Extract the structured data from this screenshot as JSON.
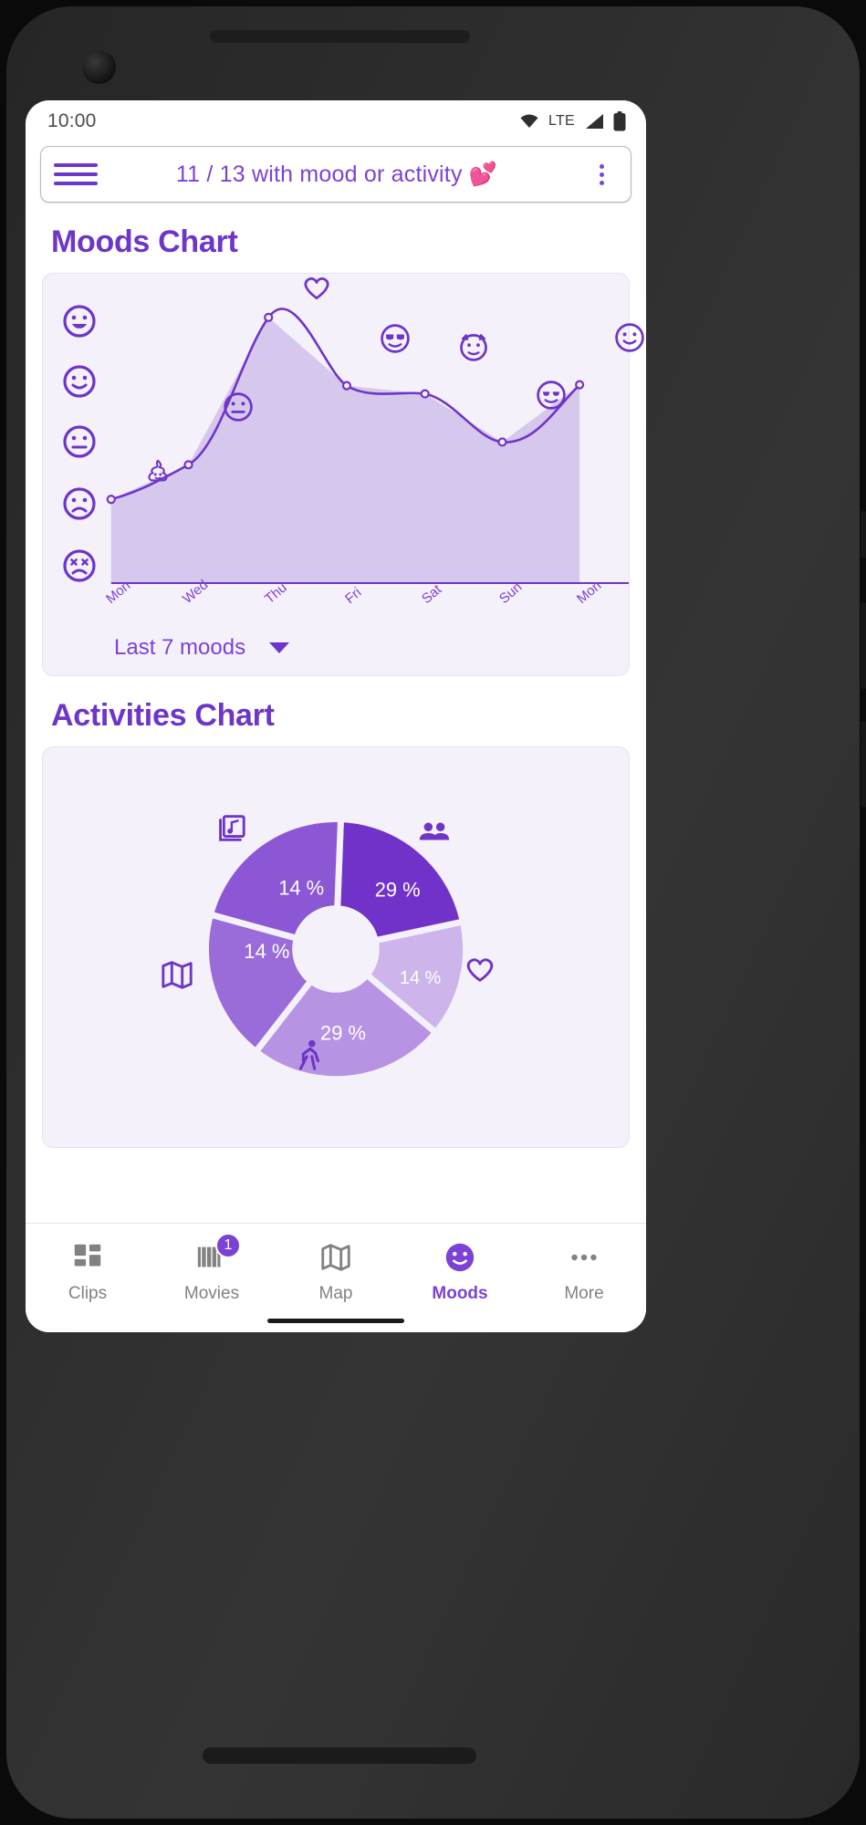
{
  "status_bar": {
    "time": "10:00",
    "network_label": "LTE",
    "icons": [
      "wifi-icon",
      "signal-icon",
      "battery-icon"
    ]
  },
  "app_bar": {
    "menu_icon": "hamburger-menu-icon",
    "title": "11 / 13 with mood or activity 💕",
    "overflow_icon": "kebab-menu-icon"
  },
  "moods_section": {
    "heading": "Moods Chart",
    "range_selector": {
      "label": "Last 7 moods",
      "caret_icon": "chevron-down-icon"
    }
  },
  "activities_section": {
    "heading": "Activities Chart"
  },
  "fabs": {
    "left": {
      "icon": "scissors-icon"
    },
    "right": {
      "icon": "video-camera-icon"
    }
  },
  "bottom_nav": {
    "items": [
      {
        "label": "Clips",
        "icon": "grid-clips-icon",
        "active": false,
        "badge": ""
      },
      {
        "label": "Movies",
        "icon": "movie-icon",
        "active": false,
        "badge": "1"
      },
      {
        "label": "Map",
        "icon": "map-icon",
        "active": false,
        "badge": ""
      },
      {
        "label": "Moods",
        "icon": "smiley-icon",
        "active": true,
        "badge": ""
      },
      {
        "label": "More",
        "icon": "ellipsis-icon",
        "active": false,
        "badge": ""
      }
    ]
  },
  "colors": {
    "primary": "#7b42d6",
    "primary_dark": "#6d35c8",
    "card_bg": "#f5f1fa",
    "area_fill": "#d4c4ec",
    "pie_1": "#7132c9",
    "pie_2": "#8c57d4",
    "pie_3": "#9a6cd9",
    "pie_4": "#b694e3",
    "pie_5": "#cdb5ec",
    "accent_pink": "#ff4d87"
  },
  "chart_data": [
    {
      "type": "area",
      "title": "Moods Chart",
      "xlabel": "",
      "ylabel": "",
      "categories": [
        "Mon",
        "Wed",
        "Thu",
        "Fri",
        "Sat",
        "Sun",
        "Mon"
      ],
      "x_tick_labels": [
        "Mon",
        "Wed",
        "Thu",
        "Fri",
        "Sat",
        "Sun",
        "Mon"
      ],
      "y_tick_icons": [
        "very-happy-icon",
        "happy-icon",
        "neutral-icon",
        "sad-icon",
        "very-sad-icon"
      ],
      "ylim": [
        1,
        5
      ],
      "grid": false,
      "legend": "none",
      "values": [
        2,
        3,
        5,
        4,
        4.1,
        3.4,
        4.3
      ],
      "point_icons": [
        {
          "x": "Mon",
          "icon": "poop-icon"
        },
        {
          "x": "Wed",
          "icon": "neutral-icon"
        },
        {
          "x": "Thu",
          "icon": "heart-icon"
        },
        {
          "x": "Fri",
          "icon": "sunglasses-icon"
        },
        {
          "x": "Sat",
          "icon": "devil-icon"
        },
        {
          "x": "Sun",
          "icon": "cool-icon"
        },
        {
          "x": "Mon2",
          "icon": "smiley-icon"
        }
      ],
      "range": "Last 7 moods"
    },
    {
      "type": "pie",
      "title": "Activities Chart",
      "labels": [
        "People",
        "Heart",
        "Running",
        "Map",
        "Music"
      ],
      "values": [
        29,
        14,
        29,
        14,
        14
      ],
      "display_labels": [
        "29 %",
        "14 %",
        "29 %",
        "14 %",
        "14 %"
      ],
      "slice_icons": [
        "people-icon",
        "heart-icon",
        "running-icon",
        "map-icon",
        "music-photos-icon"
      ],
      "slice_colors": [
        "#7132c9",
        "#cdb5ec",
        "#b694e3",
        "#9a6cd9",
        "#8c57d4"
      ],
      "donut": true,
      "legend": "icons-around-chart"
    }
  ]
}
